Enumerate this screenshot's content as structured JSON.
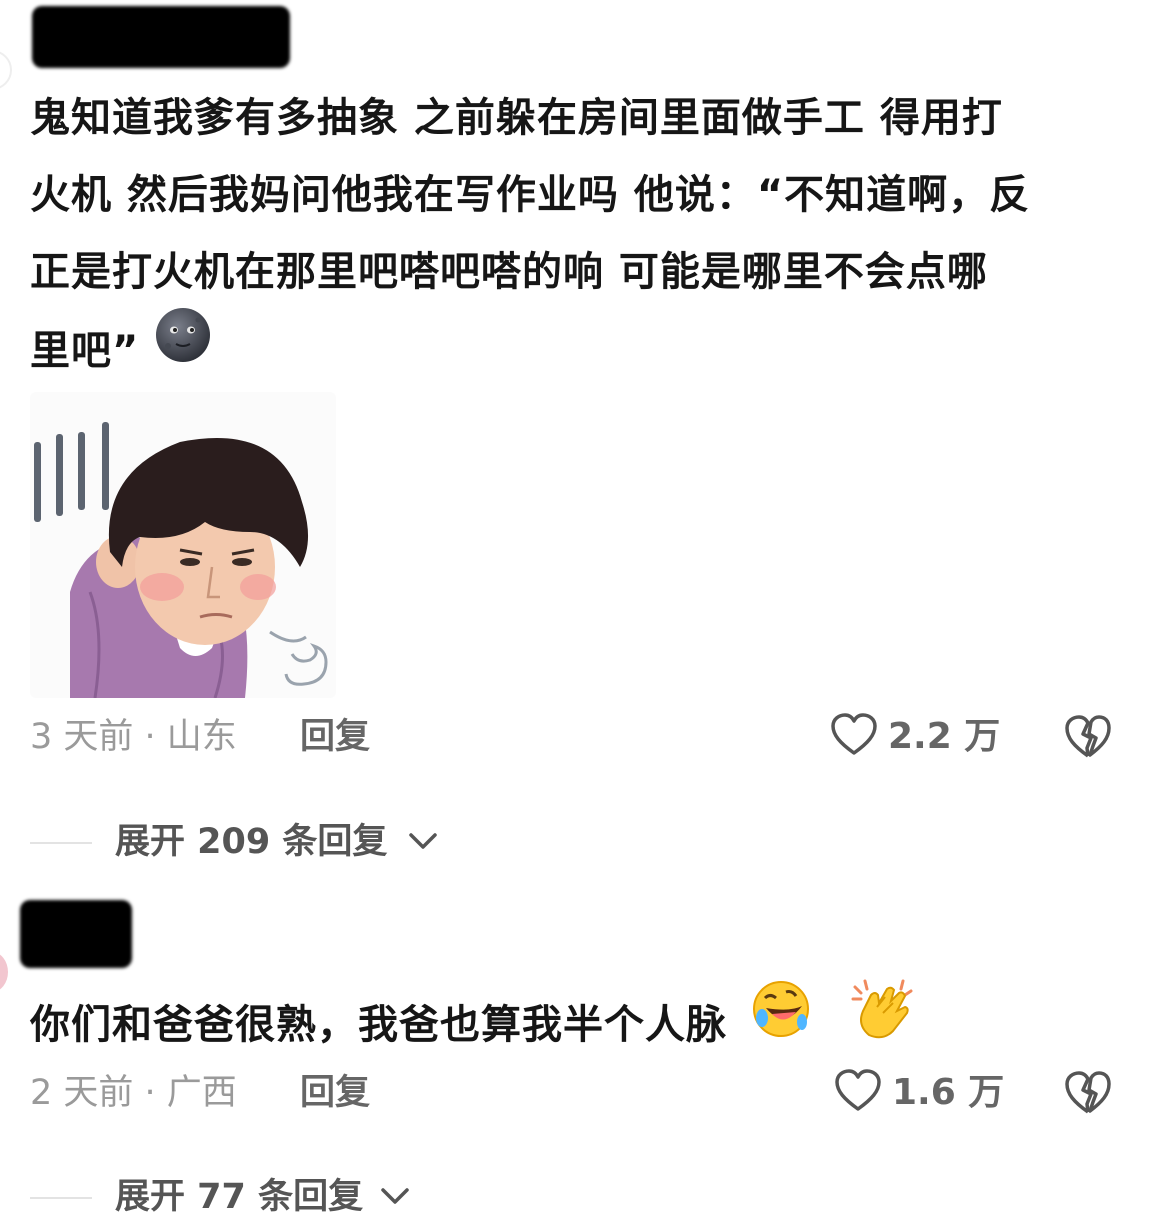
{
  "comments": [
    {
      "text_lines": [
        "鬼知道我爹有多抽象 之前躲在房间里面做手工 得用打",
        "火机 然后我妈问他我在写作业吗 他说：“不知道啊，反",
        "正是打火机在那里吧嗒吧嗒的响 可能是哪里不会点哪",
        "里吧”"
      ],
      "emoji_icon": "new-moon-face-icon",
      "time_location": "3 天前 · 山东",
      "reply_label": "回复",
      "like_count": "2.2 万",
      "expand_label": "展开 209 条回复"
    },
    {
      "text": "你们和爸爸很熟，我爸也算我半个人脉",
      "emoji_icons": [
        "rolling-laughing-face-icon",
        "clapping-hands-icon"
      ],
      "time_location": "2 天前 · 广西",
      "reply_label": "回复",
      "like_count": "1.6 万",
      "expand_label": "展开 77 条回复"
    }
  ],
  "colors": {
    "text": "#161616",
    "meta": "#9a9a9a",
    "action": "#666666",
    "sticker_shirt": "#a779ae",
    "sticker_hair": "#2a1d1d"
  }
}
